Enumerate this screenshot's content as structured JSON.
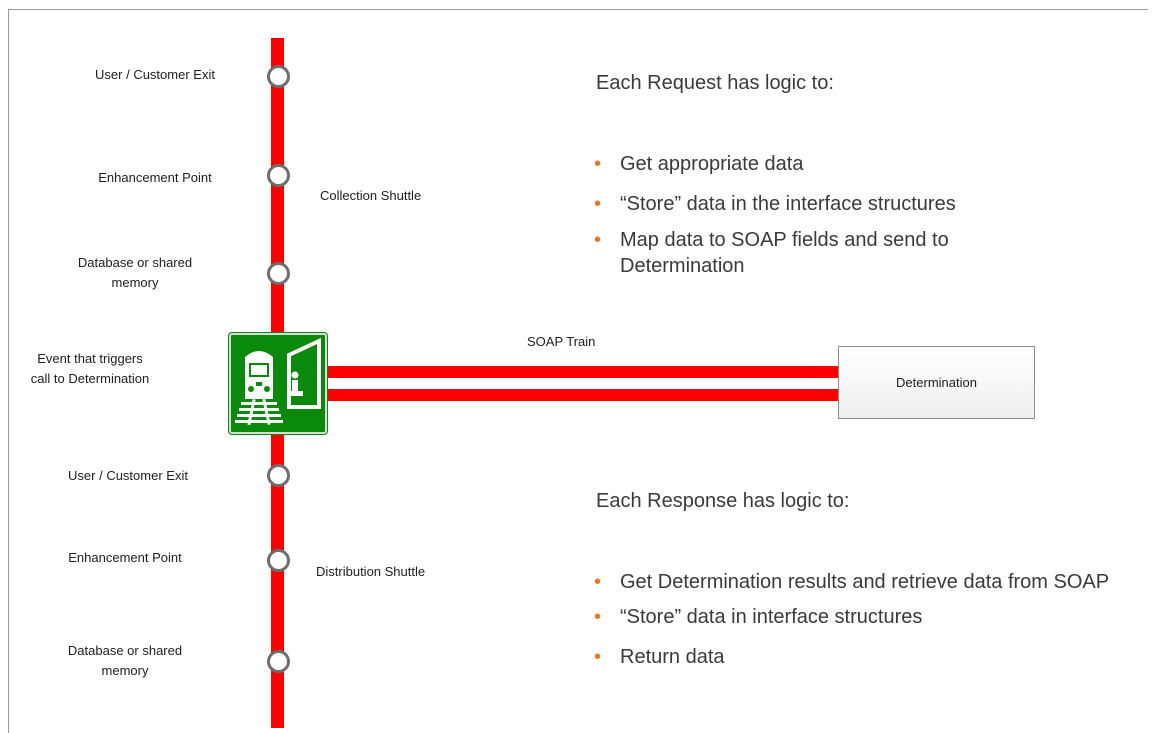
{
  "left_labels": {
    "top_exit": "User / Customer Exit",
    "top_enhancement": "Enhancement Point",
    "top_database": "Database or shared memory",
    "event": "Event that triggers call to Determination",
    "bottom_exit": "User / Customer Exit",
    "bottom_enhancement": "Enhancement Point",
    "bottom_database": "Database or shared memory"
  },
  "shuttles": {
    "collection": "Collection Shuttle",
    "distribution": "Distribution Shuttle"
  },
  "train_label": "SOAP Train",
  "determination_box": "Determination",
  "request": {
    "heading": "Each Request has logic to:",
    "items": [
      "Get appropriate data",
      "“Store” data in the interface structures",
      "Map data to SOAP fields and send to Determination"
    ]
  },
  "response": {
    "heading": "Each Response has logic to:",
    "items": [
      "Get Determination results and retrieve data from SOAP",
      "“Store” data in interface structures",
      "Return data"
    ]
  },
  "icons": {
    "station": "train-station-icon"
  },
  "colors": {
    "rail": "#ff0000",
    "station_bg": "#0a8a0a",
    "bullet": "#e6781e"
  }
}
